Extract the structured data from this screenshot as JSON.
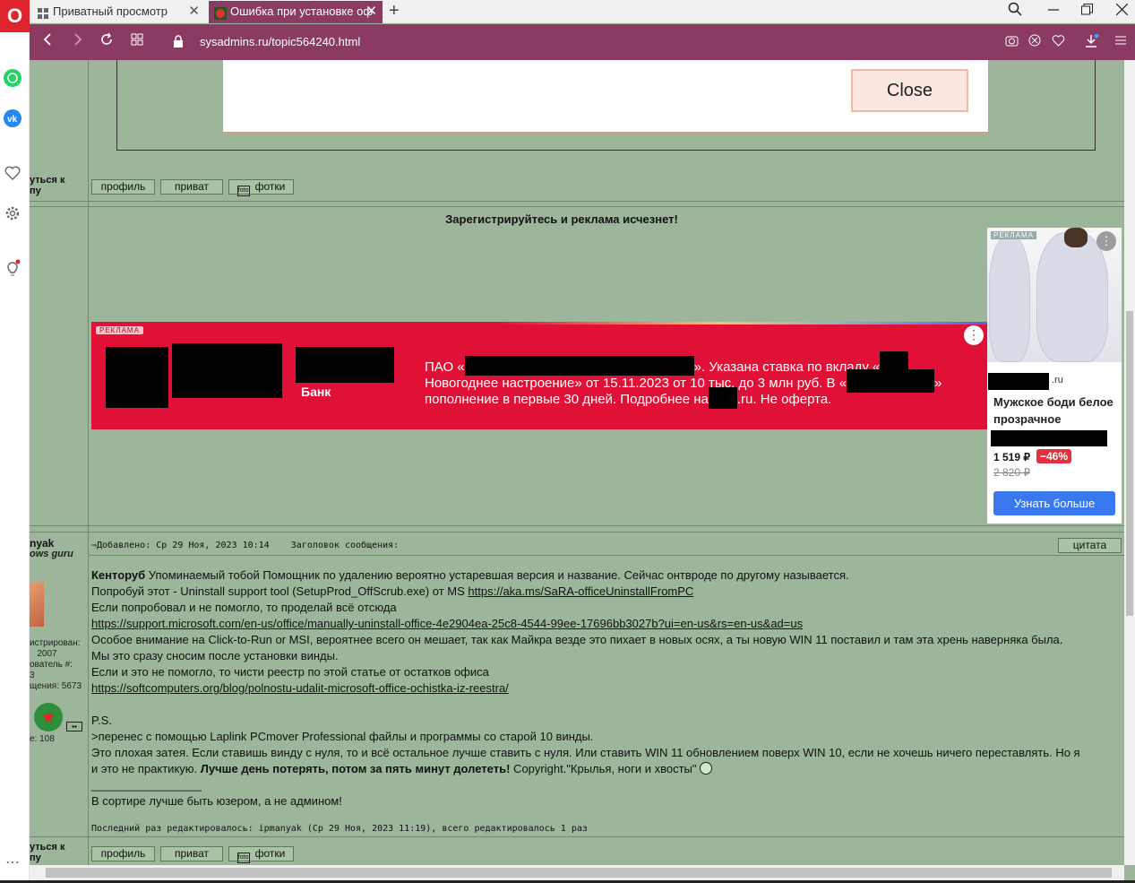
{
  "browser": {
    "logo": "O",
    "tabs": [
      {
        "label": "Приватный просмотр",
        "close": "✕"
      },
      {
        "label": "Ошибка при установке оф",
        "close": "✕"
      }
    ],
    "new_tab": "+",
    "url": "sysadmins.ru/topic564240.html"
  },
  "dialog": {
    "close_label": "Close"
  },
  "buttons": {
    "profile": "профиль",
    "private": "приват",
    "photos": "фотки",
    "quote": "цитата"
  },
  "side_label": [
    "уться к",
    "пу"
  ],
  "register_message": "Зарегистрируйтесь и реклама исчезнет!",
  "bank_ad": {
    "badge": "РЕКЛАМА",
    "bank": "Банк",
    "line1_start": "ПАО «",
    "line1_end": "». Указана ставка по вкладу «",
    "line2_start": "Новогоднее настроение» от 15.11.2023 от 10 тыс. до 3 млн руб. В «",
    "line2_end": "»",
    "line3_start": "пополнение в первые 30 дней. Подробнее на",
    "line3_end": ".ru. Не оферта."
  },
  "product_ad": {
    "badge": "РЕКЛАМА",
    "domain_suffix": ".ru",
    "title": "Мужское боди белое прозрачное",
    "price": "1 519 ₽",
    "discount": "−46%",
    "old_price": "2 820 ₽",
    "cta": "Узнать больше"
  },
  "author": {
    "name": "nyak",
    "rank": "ows guru",
    "registered": "истрирован:",
    "registered_year": "2007",
    "user_num": "ователь #:",
    "user_num_value": "3",
    "posts": "щения: 5673",
    "extra": "е: 108"
  },
  "post": {
    "header_added": "⇒Добавлено: Ср 29 Ноя, 2023 10:14",
    "header_title": "Заголовок сообщения:",
    "lead_bold": "Кенторуб",
    "line1": " Упоминаемый тобой Помощник по удалению вероятно устаревшая версия и название. Сейчас онтвроде по другому называется.",
    "line2": "Попробуй этот - Uninstall support tool (SetupProd_OffScrub.exe) от MS ",
    "link1": "https://aka.ms/SaRA-officeUninstallFromPC",
    "line3": "Если попробовал и не помогло, то проделай всё отсюда",
    "link2": "https://support.microsoft.com/en-us/office/manually-uninstall-office-4e2904ea-25c8-4544-99ee-17696bb3027b?ui=en-us&rs=en-us&ad=us",
    "line4": "Особое внимание на Click-to-Run or MSI, вероятнее всего он мешает, так как Майкра везде это пихает в новых осях, а ты новую WIN 11 поставил и там эта хрень наверняка была.",
    "line5": "Мы это сразу сносим после установки винды.",
    "line6": "Если и это не помогло, то чисти реестр по этой статье от остатков офиса",
    "link3": "https://softcomputers.org/blog/polnostu-udalit-microsoft-office-ochistka-iz-reestra/",
    "ps": "P.S.",
    "line7": ">перенес с помощью Laplink PCmover Professional файлы и программы со старой 10 винды.",
    "line8": "Это плохая затея. Если ставишь винду с нуля, то и всё остальное лучше ставить с нуля. Или ставить WIN 11 обновлением поверх WIN 10, если не хочешь ничего переставлять. Но я",
    "line9_start": "и это не практикую. ",
    "line9_bold": "Лучше день потерять, потом за пять минут долететь!",
    "line9_end": " Copyright.\"Крылья, ноги и хвосты\"",
    "separator": "_________________",
    "signature": "В сортире лучше быть юзером, а не админом!",
    "edited": "Последний раз редактировалось: ipmanyak (Ср 29 Ноя, 2023 11:19), всего редактировалось 1 раз"
  }
}
